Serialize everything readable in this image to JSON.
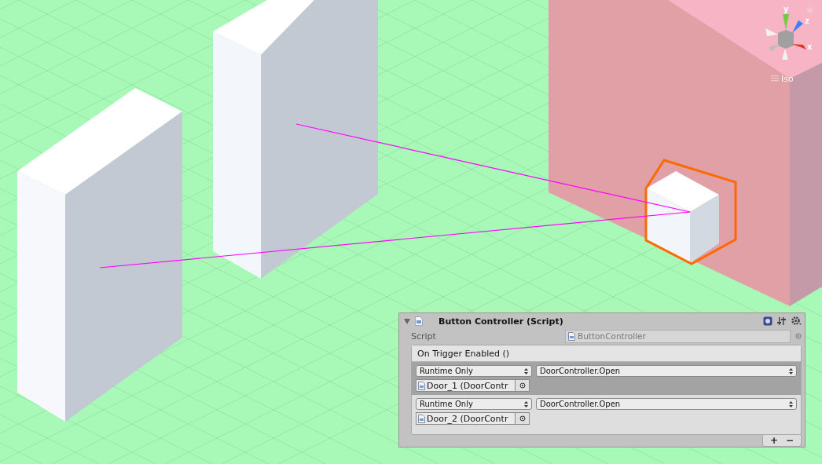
{
  "scene": {
    "gizmo": {
      "axes": [
        {
          "label": "y",
          "color": "#7ac943"
        },
        {
          "label": "z",
          "color": "#3d7ff0"
        },
        {
          "label": "x",
          "color": "#d63a2a"
        }
      ],
      "projection": "Iso"
    }
  },
  "component": {
    "title": "Button Controller (Script)",
    "expanded": true,
    "script": {
      "label": "Script",
      "value": "ButtonController",
      "disabled": true
    },
    "event": {
      "header": "On Trigger Enabled ()",
      "entries": [
        {
          "mode": "Runtime Only",
          "function": "DoorController.Open",
          "target": "Door_1 (DoorContr",
          "selected": true
        },
        {
          "mode": "Runtime Only",
          "function": "DoorController.Open",
          "target": "Door_2 (DoorContr",
          "selected": false
        }
      ],
      "add": "+",
      "remove": "−"
    }
  }
}
